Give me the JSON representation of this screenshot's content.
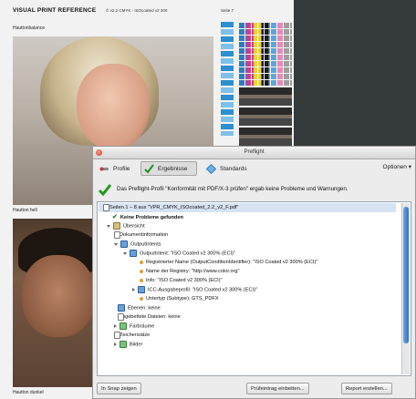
{
  "document": {
    "title": "VISUAL PRINT REFERENCE",
    "subtitle": "© v2.2 CMYK · ISOcoated v2 300",
    "page_label": "Seite 7",
    "label_top": "Hauttonbalance",
    "label_middle": "Hautton hell",
    "label_bottom": "Hautton dunkel"
  },
  "preflight": {
    "window_title": "Preflight",
    "tabs": [
      {
        "label": "Profile",
        "icon": "wrench-icon"
      },
      {
        "label": "Ergebnisse",
        "icon": "checkmark-icon"
      },
      {
        "label": "Standards",
        "icon": "diamond-icon"
      }
    ],
    "options_label": "Optionen",
    "summary": "Das Preflight-Profil \"Konformität mit PDF/X-3 prüfen\" ergab keine Probleme und Warnungen.",
    "tree": [
      "Seiten 1 – 8 aus \"VPR_CMYK_ISOcoated_2.2_v2_F.pdf\"",
      "Keine Probleme gefunden",
      "Übersicht",
      "Dokumentinformation",
      "OutputIntents",
      "OutputIntent: \"ISO Coated v2 300% (ECI)\"",
      "Registrierter Name (OutputConditionIdentifier): \"ISO Coated v2 300% (ECI)\"",
      "Name der Registry: \"http://www.color.org\"",
      "Info: \"ISO Coated v2 300% (ECI)\"",
      "ICC-Ausgabeprofil: \"ISO Coated v2 300% (ECI)\"",
      "Untertyp (Subtype): GTS_PDFX",
      "Ebenen: keine",
      "Eingebettete Dateien: keine",
      "Farbräume",
      "Zeichensätze",
      "Bilder"
    ],
    "buttons": {
      "snap": "In Snap zeigen",
      "embed": "Prüfeintrag einbetten...",
      "report": "Report erstellen..."
    }
  }
}
